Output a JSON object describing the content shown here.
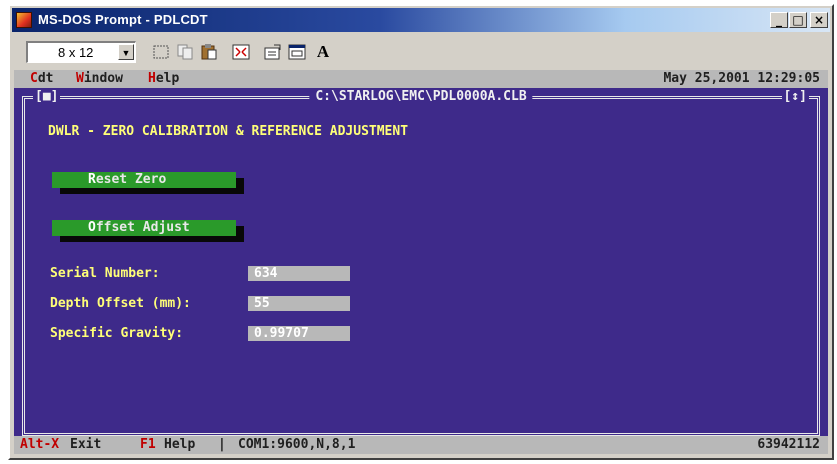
{
  "window": {
    "title": "MS-DOS Prompt - PDLCDT",
    "minimize_glyph": "_",
    "maximize_glyph": "□",
    "close_glyph": "×"
  },
  "toolbar": {
    "font_size_value": "8 x 12",
    "font_button_label": "A",
    "icons": [
      "mark-icon",
      "copy-icon",
      "paste-icon",
      "fullscreen-icon",
      "properties-icon",
      "background-icon",
      "font-icon"
    ]
  },
  "menubar": {
    "items": [
      {
        "hot": "C",
        "rest": "dt"
      },
      {
        "hot": "W",
        "rest": "indow"
      },
      {
        "hot": "H",
        "rest": "elp"
      }
    ],
    "datetime": "May 25,2001 12:29:05"
  },
  "frame": {
    "title": "C:\\STARLOG\\EMC\\PDL0000A.CLB",
    "left_tag": "[■]",
    "right_tag": "[↕]"
  },
  "screen": {
    "heading": "DWLR - ZERO CALIBRATION & REFERENCE ADJUSTMENT",
    "buttons": [
      {
        "hot": "R",
        "rest": "eset Zero"
      },
      {
        "hot": "O",
        "rest": "ffset Adjust"
      }
    ],
    "fields": [
      {
        "label": "Serial Number:",
        "value": "634"
      },
      {
        "label": "Depth Offset (mm):",
        "value": "55"
      },
      {
        "label": "Specific Gravity:",
        "value": "0.99707"
      }
    ]
  },
  "statusbar": {
    "exit_key": "Alt-X",
    "exit_label": "Exit",
    "help_key": "F1",
    "help_label": "Help",
    "separator": "|",
    "port": "COM1:9600,N,8,1",
    "number": "63942112"
  },
  "colors": {
    "console_bg": "#3e2a8a",
    "text_yellow": "#ffff78",
    "button_green": "#2a9a2a",
    "bar_gray": "#b8b8b8",
    "hotkey_red": "#c00000"
  }
}
